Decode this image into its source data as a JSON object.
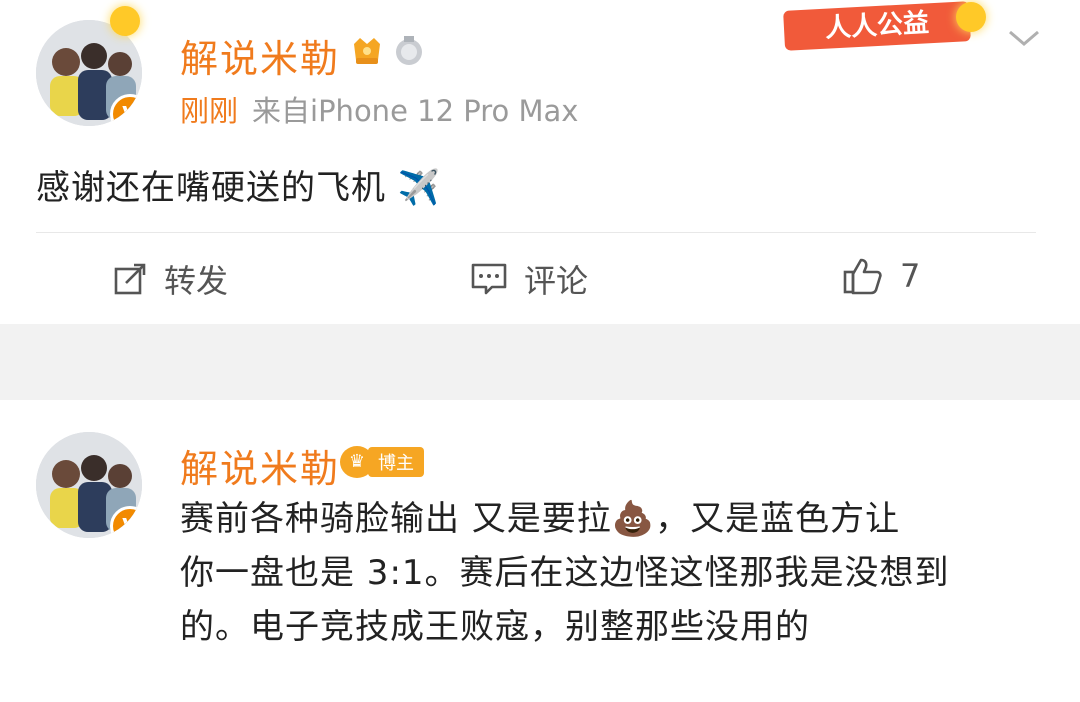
{
  "post1": {
    "username": "解说米勒",
    "time": "刚刚",
    "source": "来自iPhone 12 Pro Max",
    "text": "感谢还在嘴硬送的飞机",
    "emoji": "✈️",
    "charity_badge": "人人公益",
    "actions": {
      "repost_label": "转发",
      "comment_label": "评论",
      "like_count": "7"
    }
  },
  "post2": {
    "username": "解说米勒",
    "badge_label": "博主",
    "text_line1": "赛前各种骑脸输出 又是要拉💩，又是蓝色方让",
    "text_line2": "你一盘也是 3:1。赛后在这边怪这怪那我是没想到",
    "text_line3": "的。电子竞技成王败寇，别整那些没用的"
  },
  "colors": {
    "accent_orange": "#f07b1d",
    "meta_gray": "#9a9a9a",
    "background": "#f2f2f2"
  }
}
